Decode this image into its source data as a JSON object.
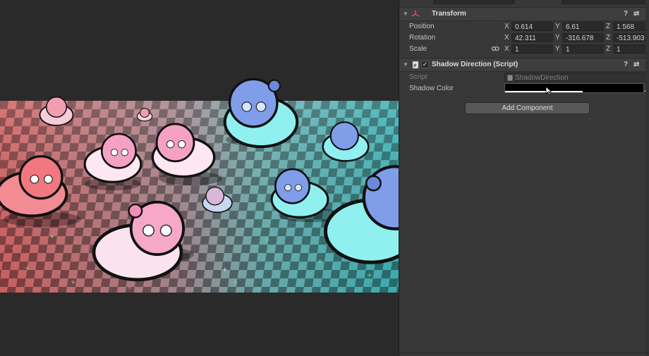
{
  "transform": {
    "title": "Transform",
    "position": {
      "label": "Position",
      "x": "0.614",
      "y": "6.61",
      "z": "1.568"
    },
    "rotation": {
      "label": "Rotation",
      "x": "42.311",
      "y": "-316.678",
      "z": "-513.903"
    },
    "scale": {
      "label": "Scale",
      "x": "1",
      "y": "1",
      "z": "1"
    }
  },
  "shadow_direction": {
    "title": "Shadow Direction (Script)",
    "script_label": "Script",
    "script_value": "ShadowDirection",
    "shadow_color_label": "Shadow Color",
    "shadow_color": "#000000"
  },
  "axes": {
    "x": "X",
    "y": "Y",
    "z": "Z"
  },
  "buttons": {
    "add_component": "Add Component",
    "help": "?",
    "settings": "⇄",
    "more": "⋮"
  },
  "icons": {
    "transform": "transform-icon",
    "script": "script-icon",
    "link": "link-icon",
    "eyedropper": "eyedropper-icon"
  },
  "colors": {
    "floor_left": "#c4575a",
    "floor_right": "#3ea7a8",
    "pink_creature": "#f7a7c8",
    "cyan_creature": "#8ff0ef",
    "blue_hair": "#7f9de8"
  }
}
